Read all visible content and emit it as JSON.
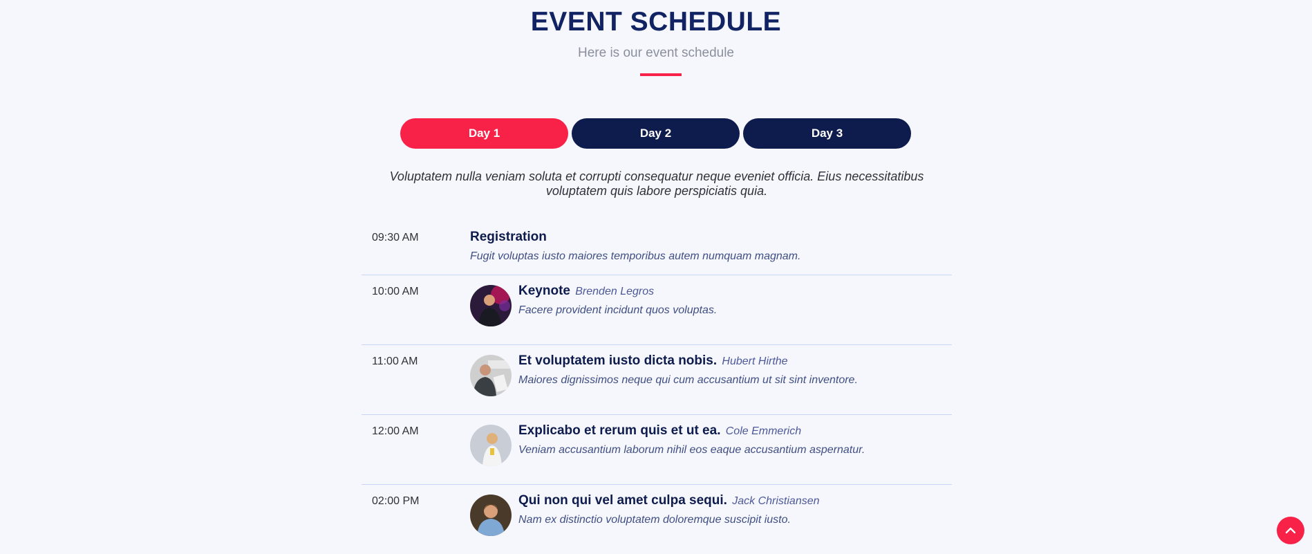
{
  "header": {
    "title": "EVENT SCHEDULE",
    "subtitle": "Here is our event schedule"
  },
  "tabs": [
    {
      "label": "Day 1",
      "active": true
    },
    {
      "label": "Day 2",
      "active": false
    },
    {
      "label": "Day 3",
      "active": false
    }
  ],
  "intro": "Voluptatem nulla veniam soluta et corrupti consequatur neque eveniet officia. Eius necessitatibus voluptatem quis labore perspiciatis quia.",
  "schedule": [
    {
      "time": "09:30 AM",
      "title": "Registration",
      "speaker": "",
      "description": "Fugit voluptas iusto maiores temporibus autem numquam magnam."
    },
    {
      "time": "10:00 AM",
      "title": "Keynote",
      "speaker": "Brenden Legros",
      "description": "Facere provident incidunt quos voluptas."
    },
    {
      "time": "11:00 AM",
      "title": "Et voluptatem iusto dicta nobis.",
      "speaker": "Hubert Hirthe",
      "description": "Maiores dignissimos neque qui cum accusantium ut sit sint inventore."
    },
    {
      "time": "12:00 AM",
      "title": "Explicabo et rerum quis et ut ea.",
      "speaker": "Cole Emmerich",
      "description": "Veniam accusantium laborum nihil eos eaque accusantium aspernatur."
    },
    {
      "time": "02:00 PM",
      "title": "Qui non qui vel amet culpa sequi.",
      "speaker": "Jack Christiansen",
      "description": "Nam ex distinctio voluptatem doloremque suscipit iusto."
    }
  ],
  "icons": {
    "back_to_top": "chevron-up-icon"
  },
  "colors": {
    "accent": "#f82249",
    "navy": "#0e1b4d",
    "title": "#112363",
    "background": "#f6f7fd"
  }
}
